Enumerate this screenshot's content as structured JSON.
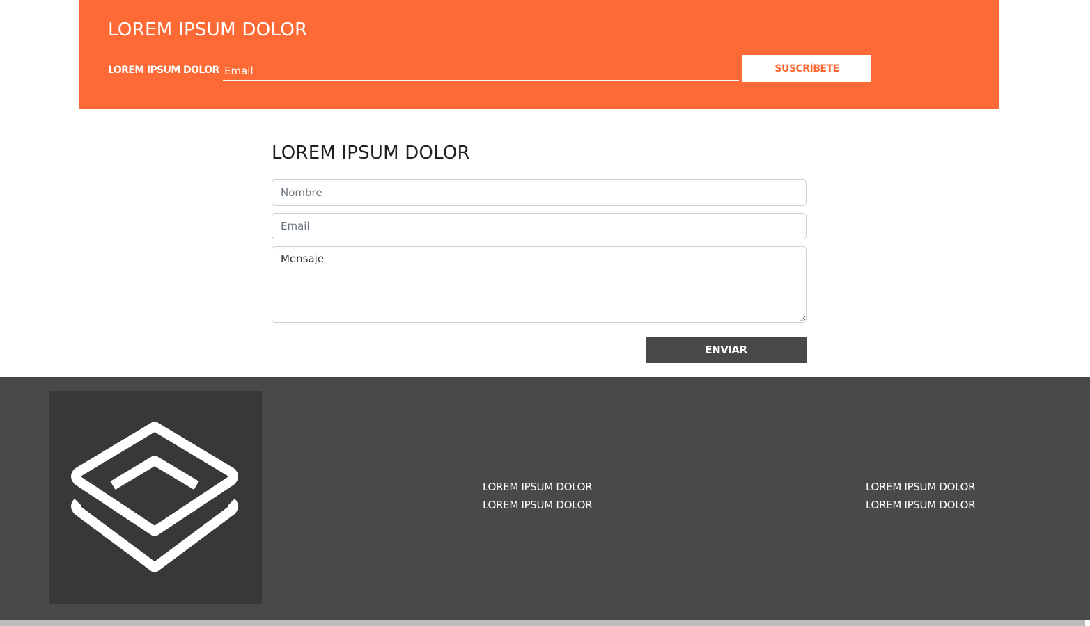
{
  "subscribe": {
    "title": "LOREM IPSUM DOLOR",
    "label": "LOREM IPSUM DOLOR",
    "email_placeholder": "Email",
    "button_label": "SUSCRÍBETE",
    "colors": {
      "background": "#fd6a35",
      "text": "#ffffff"
    }
  },
  "contact": {
    "title": "LOREM IPSUM DOLOR",
    "name_placeholder": "Nombre",
    "email_placeholder": "Email",
    "message_placeholder": "Mensaje",
    "send_label": "ENVIAR",
    "colors": {
      "button": "#494949"
    }
  },
  "footer": {
    "logo_icon": "stacked-layers-icon",
    "columns": [
      {
        "links": [
          "LOREM IPSUM DOLOR",
          "LOREM IPSUM DOLOR"
        ]
      },
      {
        "links": [
          "LOREM IPSUM DOLOR",
          "LOREM IPSUM DOLOR"
        ]
      }
    ],
    "colors": {
      "background": "#494949",
      "logo_background": "#383838"
    }
  }
}
